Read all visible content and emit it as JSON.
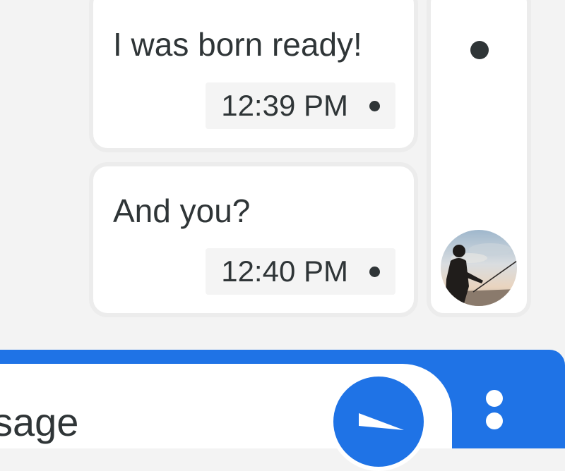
{
  "messages": [
    {
      "text": "I was born ready!",
      "time": "12:39 PM",
      "status": "sent"
    },
    {
      "text": "And you?",
      "time": "12:40 PM",
      "status": "sent"
    }
  ],
  "composer": {
    "placeholder_visible": "sage",
    "send_icon": "send-icon",
    "more_icon": "more-vertical-icon"
  },
  "colors": {
    "accent": "#1f73e6",
    "bubble": "#ffffff",
    "text": "#2f3537",
    "background": "#f3f3f3"
  }
}
